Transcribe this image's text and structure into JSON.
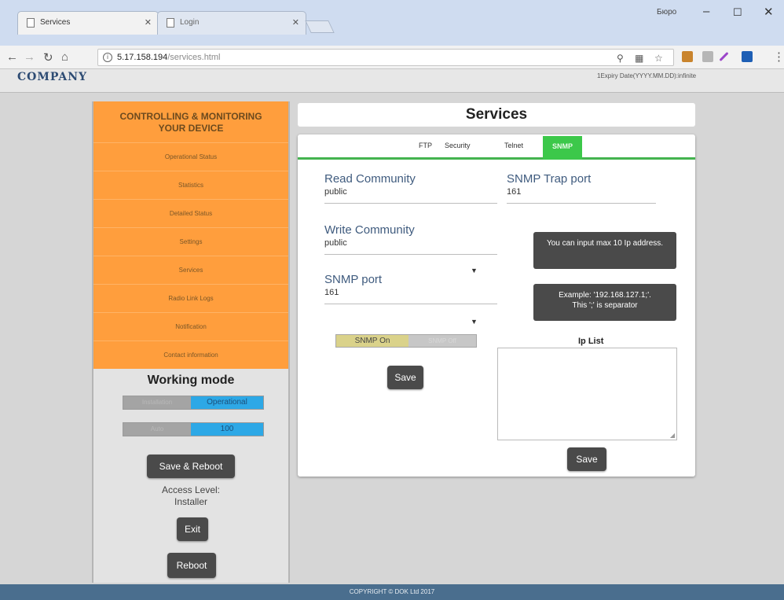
{
  "browser": {
    "tabs": [
      {
        "label": "Services"
      },
      {
        "label": "Login"
      }
    ],
    "user": "Бюро",
    "url_host": "5.17.158.194",
    "url_path": "/services.html"
  },
  "site": {
    "logo": "COMPANY",
    "expiry": "1Expiry Date(YYYY.MM.DD):infinite"
  },
  "sidebar": {
    "heading_line1": "CONTROLLING & MONITORING",
    "heading_line2": "YOUR DEVICE",
    "items": [
      {
        "label": "Operational Status"
      },
      {
        "label": "Statistics"
      },
      {
        "label": "Detailed Status"
      },
      {
        "label": "Settings"
      },
      {
        "label": "Services"
      },
      {
        "label": "Radio Link Logs"
      },
      {
        "label": "Notification"
      },
      {
        "label": "Contact information"
      }
    ],
    "working_mode": {
      "title": "Working mode",
      "mode_off": "Installation",
      "mode_on": "Operational",
      "speed_off": "Auto",
      "speed_on": "100"
    },
    "save_reboot": "Save & Reboot",
    "access_label": "Access Level:",
    "access_value": "Installer",
    "exit": "Exit",
    "reboot": "Reboot"
  },
  "main": {
    "title": "Services",
    "tabs": [
      {
        "label": "FTP"
      },
      {
        "label": "Security"
      },
      {
        "label": "Telnet"
      },
      {
        "label": "SNMP",
        "active": true
      }
    ],
    "read_community": {
      "label": "Read Community",
      "value": "public"
    },
    "trap_port": {
      "label": "SNMP Trap port",
      "value": "161"
    },
    "write_community": {
      "label": "Write Community",
      "value": "public"
    },
    "snmp_port": {
      "label": "SNMP port",
      "value": "161"
    },
    "toggle": {
      "on": "SNMP On",
      "off": "SNMP Off"
    },
    "save": "Save",
    "tip1": "You can input max 10 Ip address.",
    "tip2_line1": "Example: '192.168.127.1;'.",
    "tip2_line2": "This ';' is separator",
    "ip_list_label": "Ip List",
    "ip_list_value": "",
    "ip_save": "Save"
  },
  "footer": "COPYRIGHT © DOK Ltd 2017"
}
